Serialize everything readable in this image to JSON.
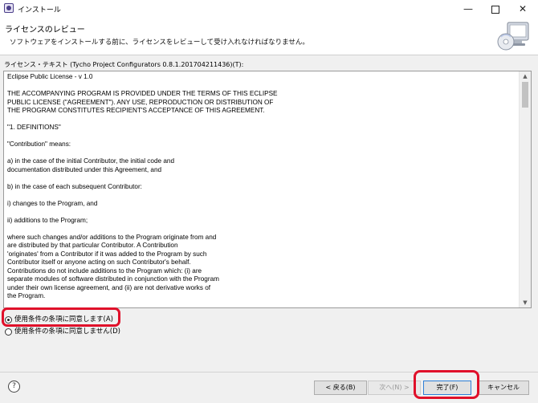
{
  "window": {
    "title": "インストール",
    "minimize_glyph": "—",
    "close_glyph": "✕"
  },
  "header": {
    "title": "ライセンスのレビュー",
    "description": "ソフトウェアをインストールする前に、ライセンスをレビューして受け入れなければなりません。",
    "icon": "install-wizard-icon"
  },
  "license": {
    "label": "ライセンス・テキスト (Tycho Project Configurators 0.8.1.201704211436)(T):",
    "paragraphs": [
      "Eclipse Public License - v 1.0",
      "THE ACCOMPANYING PROGRAM IS PROVIDED UNDER THE TERMS OF THIS ECLIPSE\nPUBLIC LICENSE (\"AGREEMENT\"). ANY USE, REPRODUCTION OR DISTRIBUTION OF\nTHE PROGRAM CONSTITUTES RECIPIENT'S ACCEPTANCE OF THIS AGREEMENT.",
      "\"1. DEFINITIONS\"",
      "\"Contribution\" means:",
      "a) in the case of the initial Contributor, the initial code and\ndocumentation distributed under this Agreement, and",
      "b) in the case of each subsequent Contributor:",
      "i) changes to the Program, and",
      "ii) additions to the Program;",
      "where such changes and/or additions to the Program originate from and\nare distributed by that particular Contributor. A Contribution\n'originates' from a Contributor if it was added to the Program by such\nContributor itself or anyone acting on such Contributor's behalf.\nContributions do not include additions to the Program which: (i) are\nseparate modules of software distributed in conjunction with the Program\nunder their own license agreement, and (ii) are not derivative works of\nthe Program."
    ]
  },
  "options": [
    {
      "label": "使用条件の条項に同意します(A)",
      "selected": true
    },
    {
      "label": "使用条件の条項に同意しません(D)",
      "selected": false
    }
  ],
  "buttons": {
    "help": "?",
    "back": "< 戻る(B)",
    "next": "次へ(N) >",
    "finish": "完了(F)",
    "cancel": "キャンセル"
  },
  "colors": {
    "annotation": "#e0102a",
    "dialog_bg": "#f0f0f0",
    "default_button_border": "#2d7fd6"
  }
}
